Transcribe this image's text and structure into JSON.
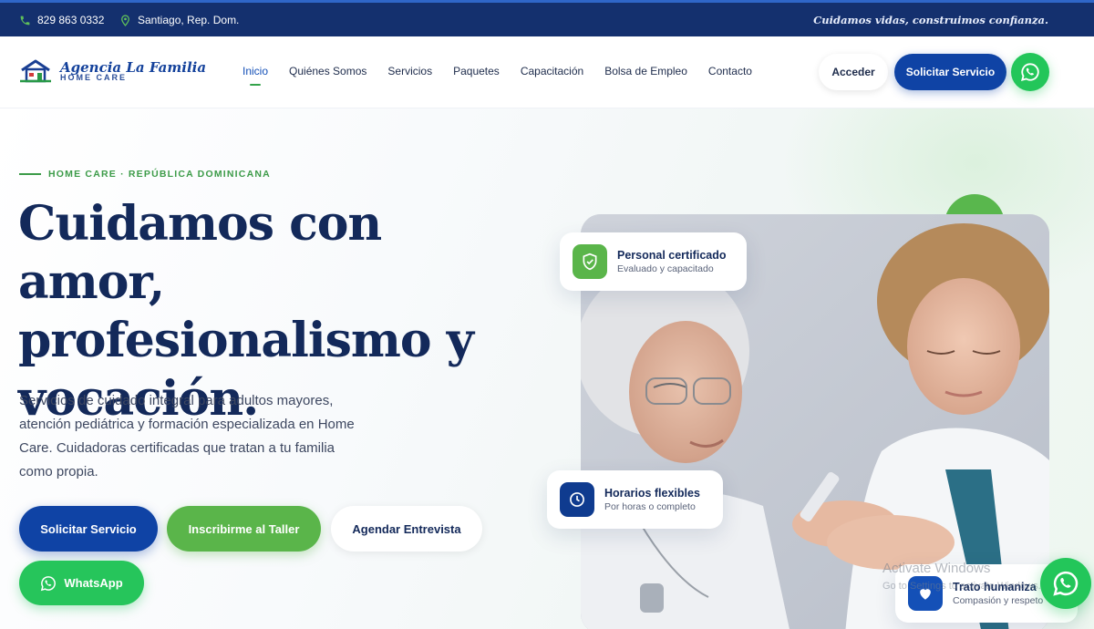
{
  "topbar": {
    "phone": "829 863 0332",
    "location": "Santiago, Rep. Dom.",
    "tagline": "Cuidamos vidas, construimos confianza."
  },
  "brand": {
    "name": "Agencia La Familia",
    "subtitle": "HOME CARE"
  },
  "nav": {
    "items": [
      {
        "label": "Inicio",
        "active": true
      },
      {
        "label": "Quiénes Somos"
      },
      {
        "label": "Servicios"
      },
      {
        "label": "Paquetes"
      },
      {
        "label": "Capacitación"
      },
      {
        "label": "Bolsa de Empleo"
      },
      {
        "label": "Contacto"
      }
    ],
    "login_label": "Acceder",
    "cta_label": "Solicitar Servicio"
  },
  "hero": {
    "eyebrow": "HOME CARE · REPÚBLICA DOMINICANA",
    "title_line1": "Cuidamos con amor,",
    "title_line2": "profesionalismo y",
    "title_line3": "vocación.",
    "description": "Servicios de cuidado integral para adultos mayores, atención pediátrica y formación especializada en Home Care. Cuidadoras certificadas que tratan a tu familia como propia.",
    "buttons": {
      "primary": "Solicitar Servicio",
      "secondary": "Inscribirme al Taller",
      "tertiary": "Agendar Entrevista",
      "whatsapp": "WhatsApp"
    }
  },
  "cards": {
    "certified": {
      "title": "Personal certificado",
      "subtitle": "Evaluado y capacitado"
    },
    "schedule": {
      "title": "Horarios flexibles",
      "subtitle": "Por horas o completo"
    },
    "humane": {
      "title": "Trato humaniza",
      "subtitle": "Compasión y respeto"
    }
  },
  "overlay": {
    "activate_title": "Activate Windows",
    "activate_sub": "Go to Settings to activate Windows."
  },
  "colors": {
    "navy": "#14306e",
    "primary_blue": "#0f43a5",
    "green": "#5ab54a",
    "whatsapp_green": "#23c65a"
  }
}
